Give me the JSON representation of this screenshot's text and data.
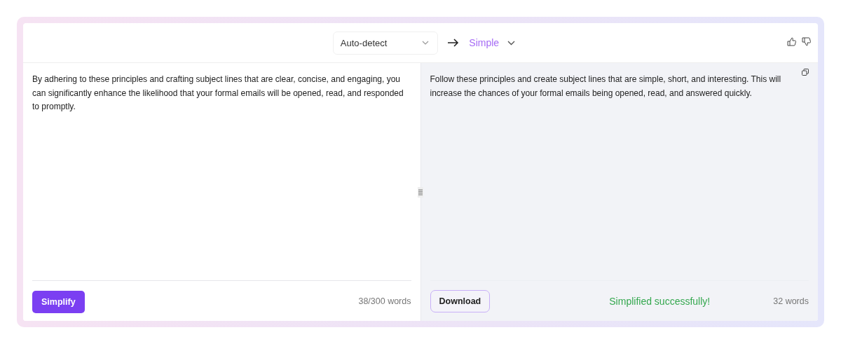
{
  "header": {
    "source_language": "Auto-detect",
    "target_mode": "Simple"
  },
  "input": {
    "text": "By adhering to these principles and crafting subject lines that are clear, concise, and engaging, you can significantly enhance the likelihood that your formal emails will be opened, read, and responded to promptly.",
    "button": "Simplify",
    "word_count": "38/300 words"
  },
  "output": {
    "text": "Follow these principles and create subject lines that are simple, short, and interesting. This will increase the chances of your formal emails being opened, read, and answered quickly.",
    "button": "Download",
    "status": "Simplified successfully!",
    "word_count": "32 words"
  }
}
